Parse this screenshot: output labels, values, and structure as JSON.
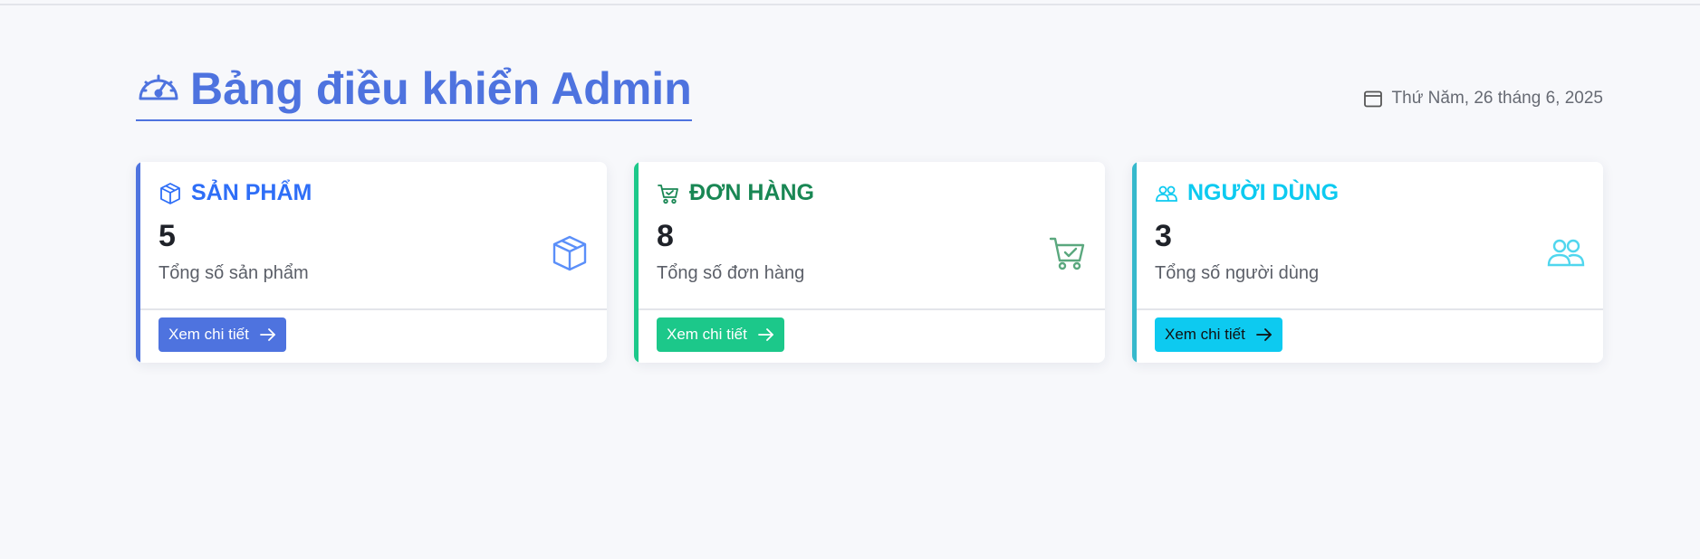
{
  "header": {
    "title": "Bảng điều khiển Admin",
    "title_icon": "speedometer-icon",
    "date": "Thứ Năm, 26 tháng 6, 2025",
    "date_icon": "calendar-icon"
  },
  "colors": {
    "primary": "#4e73df",
    "success": "#1cc88a",
    "info": "#0dcaf0",
    "background": "#f7f8fb"
  },
  "cards": [
    {
      "title": "SẢN PHẨM",
      "icon": "box-icon",
      "value": "5",
      "description": "Tổng số sản phẩm",
      "button_label": "Xem chi tiết",
      "title_color": "#2e6ef7",
      "accent": "#4e73df"
    },
    {
      "title": "ĐƠN HÀNG",
      "icon": "cart-check-icon",
      "value": "8",
      "description": "Tổng số đơn hàng",
      "button_label": "Xem chi tiết",
      "title_color": "#198754",
      "accent": "#1cc88a"
    },
    {
      "title": "NGƯỜI DÙNG",
      "icon": "people-icon",
      "value": "3",
      "description": "Tổng số người dùng",
      "button_label": "Xem chi tiết",
      "title_color": "#0dcaf0",
      "accent": "#36b9cc"
    }
  ]
}
